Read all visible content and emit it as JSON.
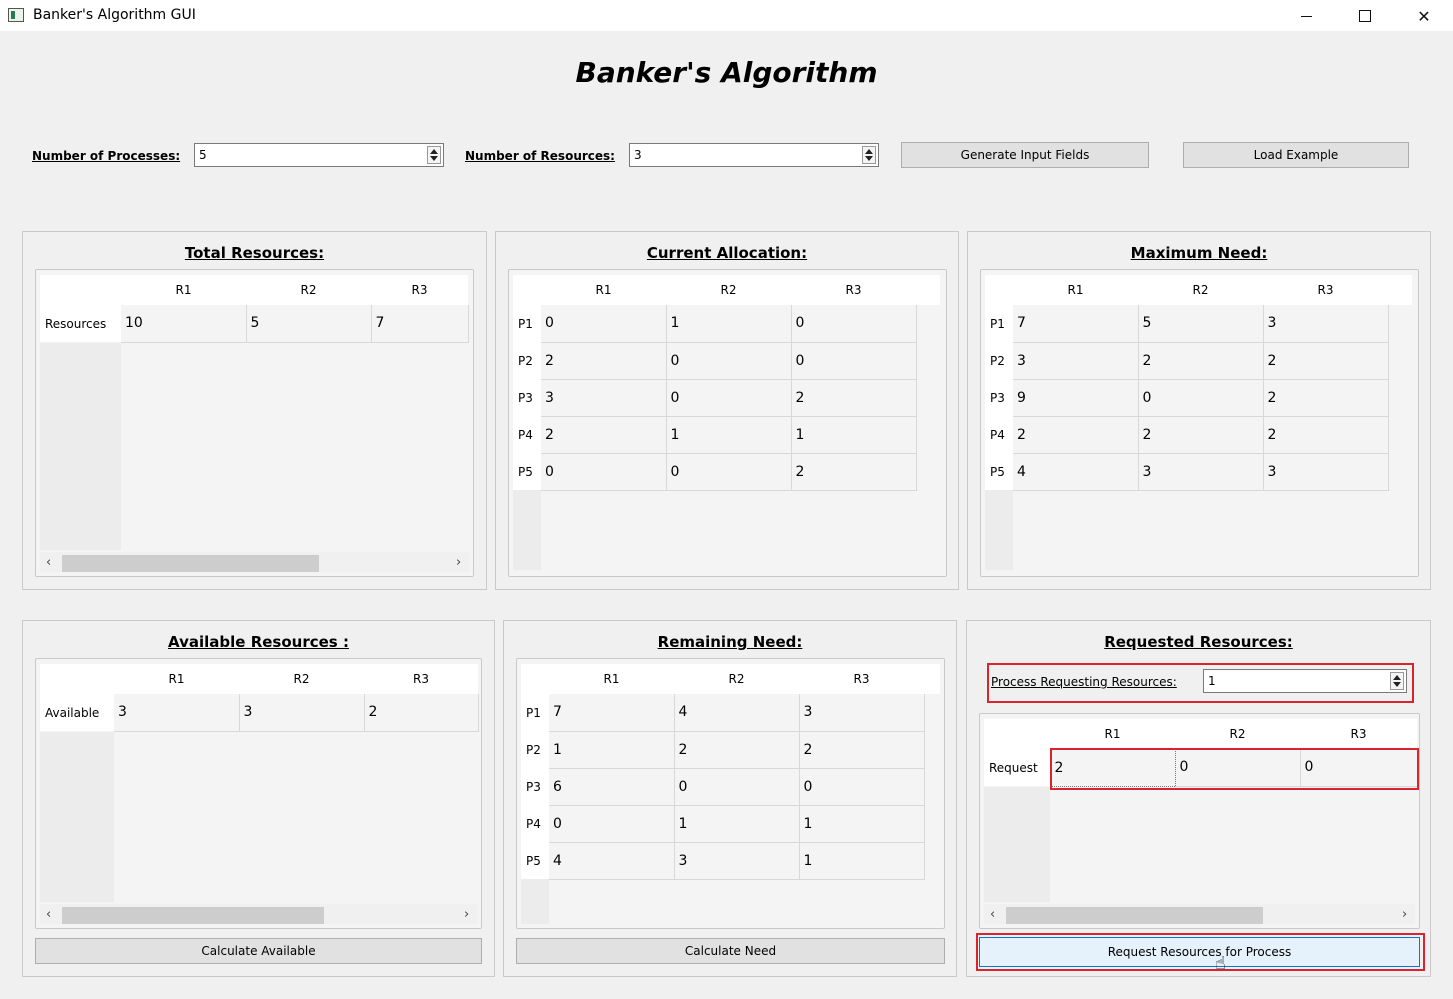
{
  "window": {
    "title": "Banker's Algorithm GUI",
    "minimize_icon": "minimize-icon",
    "maximize_icon": "maximize-icon",
    "close_icon": "close-icon",
    "close_glyph": "✕"
  },
  "heading": "Banker's Algorithm",
  "controls": {
    "processes_label": "Number of Processes:",
    "processes_value": "5",
    "resources_label": "Number of Resources:",
    "resources_value": "3",
    "generate_button": "Generate Input Fields",
    "load_button": "Load Example"
  },
  "columns": [
    "R1",
    "R2",
    "R3"
  ],
  "total_resources": {
    "title": "Total Resources:",
    "row_label": "Resources",
    "values": [
      "10",
      "5",
      "7"
    ]
  },
  "current_allocation": {
    "title": "Current Allocation:",
    "rows": [
      {
        "label": "P1",
        "values": [
          "0",
          "1",
          "0"
        ]
      },
      {
        "label": "P2",
        "values": [
          "2",
          "0",
          "0"
        ]
      },
      {
        "label": "P3",
        "values": [
          "3",
          "0",
          "2"
        ]
      },
      {
        "label": "P4",
        "values": [
          "2",
          "1",
          "1"
        ]
      },
      {
        "label": "P5",
        "values": [
          "0",
          "0",
          "2"
        ]
      }
    ]
  },
  "maximum_need": {
    "title": "Maximum Need:",
    "rows": [
      {
        "label": "P1",
        "values": [
          "7",
          "5",
          "3"
        ]
      },
      {
        "label": "P2",
        "values": [
          "3",
          "2",
          "2"
        ]
      },
      {
        "label": "P3",
        "values": [
          "9",
          "0",
          "2"
        ]
      },
      {
        "label": "P4",
        "values": [
          "2",
          "2",
          "2"
        ]
      },
      {
        "label": "P5",
        "values": [
          "4",
          "3",
          "3"
        ]
      }
    ]
  },
  "available_resources": {
    "title": "Available Resources :",
    "row_label": "Available",
    "values": [
      "3",
      "3",
      "2"
    ],
    "button": "Calculate Available"
  },
  "remaining_need": {
    "title": "Remaining Need:",
    "rows": [
      {
        "label": "P1",
        "values": [
          "7",
          "4",
          "3"
        ]
      },
      {
        "label": "P2",
        "values": [
          "1",
          "2",
          "2"
        ]
      },
      {
        "label": "P3",
        "values": [
          "6",
          "0",
          "0"
        ]
      },
      {
        "label": "P4",
        "values": [
          "0",
          "1",
          "1"
        ]
      },
      {
        "label": "P5",
        "values": [
          "4",
          "3",
          "1"
        ]
      }
    ],
    "button": "Calculate Need"
  },
  "requested_resources": {
    "title": "Requested Resources:",
    "process_label": "Process Requesting Resources:",
    "process_value": "1",
    "row_label": "Request",
    "values": [
      "2",
      "0",
      "0"
    ],
    "button": "Request Resources for Process"
  },
  "scroll_arrows": {
    "left": "‹",
    "right": "›"
  },
  "highlight_color": "#d9232d"
}
